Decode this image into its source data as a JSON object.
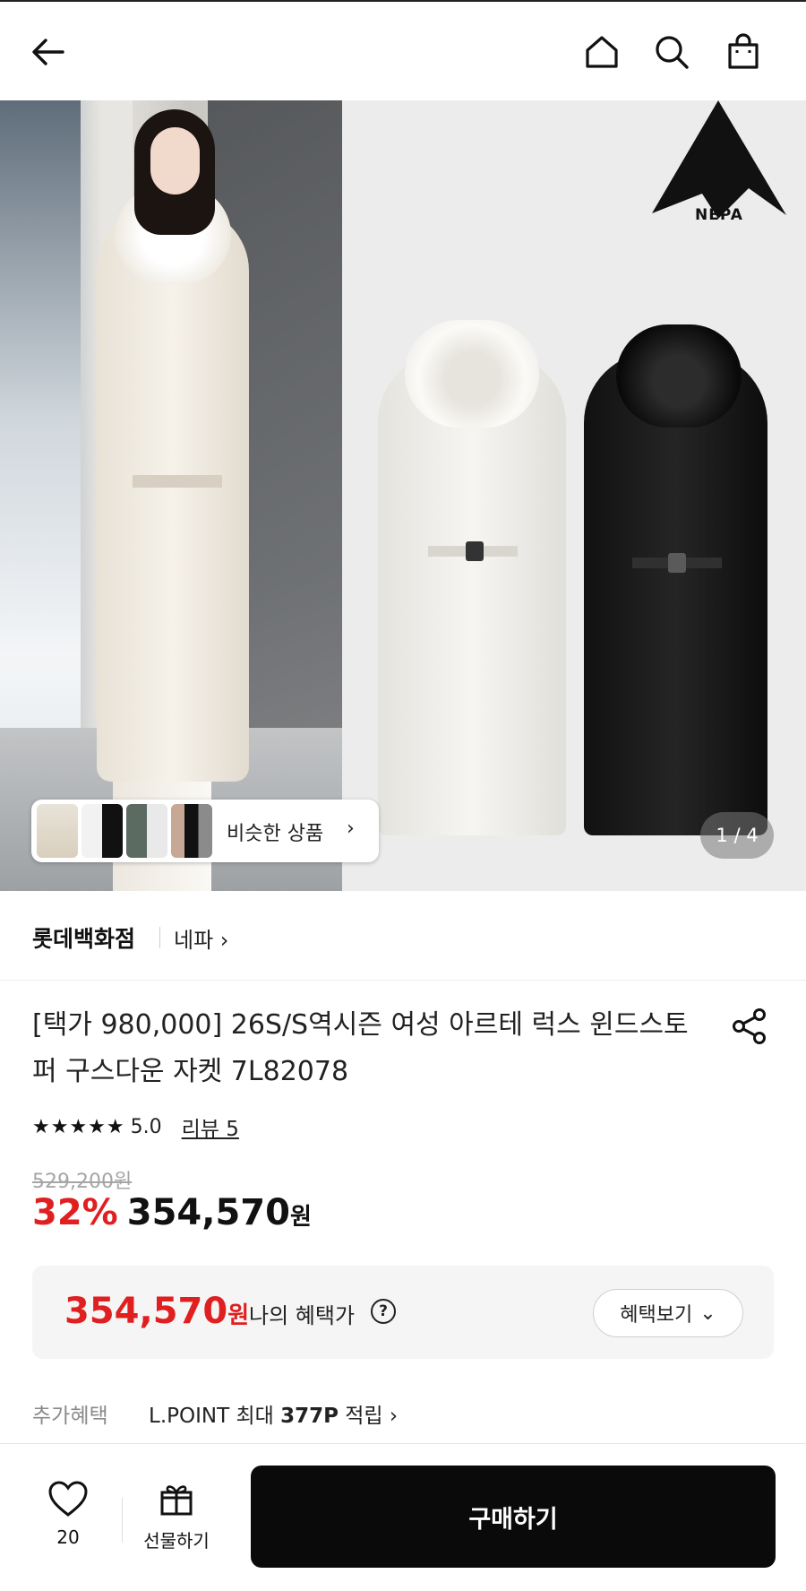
{
  "header": {
    "back_icon": "arrow-left-icon",
    "home_icon": "home-icon",
    "search_icon": "search-icon",
    "bag_icon": "shopping-bag-icon"
  },
  "gallery": {
    "brand_logo_text": "NEPA",
    "similar_label": "비슷한 상품",
    "similar_chevron": "›",
    "counter": "1 / 4"
  },
  "store": {
    "name": "롯데백화점",
    "brand": "네파 ›"
  },
  "product": {
    "title": "[택가 980,000] 26S/S역시즌 여성 아르테 럭스 윈드스토퍼 구스다운 자켓 7L82078",
    "stars": "★★★★★",
    "score": "5.0",
    "review": "리뷰 5",
    "original_price": "529,200원",
    "discount": "32%",
    "sale_price": "354,570",
    "won": "원"
  },
  "benefit": {
    "price": "354,570",
    "won": "원",
    "label": "나의 혜택가",
    "help": "?",
    "button": "혜택보기",
    "button_chevron": "⌄"
  },
  "extra": {
    "label": "추가혜택",
    "prefix": "L.POINT 최대 ",
    "points": "377P",
    "suffix": " 적립 ›"
  },
  "bottom": {
    "like_count": "20",
    "gift_label": "선물하기",
    "buy_label": "구매하기"
  },
  "colors": {
    "accent_red": "#e02020",
    "buy_button": "#0a0a0a"
  }
}
